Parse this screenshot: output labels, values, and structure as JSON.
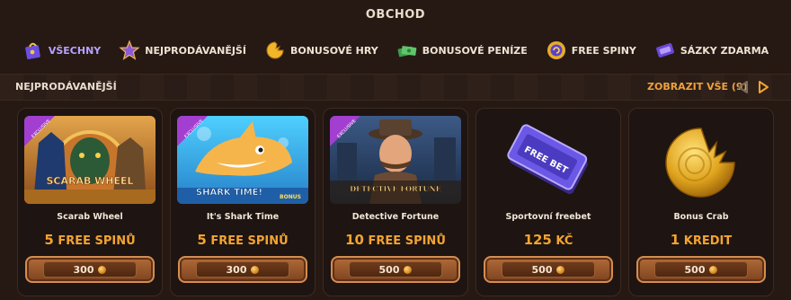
{
  "header": {
    "title": "OBCHOD"
  },
  "filters": [
    {
      "label": "VŠECHNY",
      "icon": "shopping-bag-icon",
      "active": true
    },
    {
      "label": "NEJPRODÁVANĚJŠÍ",
      "icon": "star-icon"
    },
    {
      "label": "BONUSOVÉ HRY",
      "icon": "bonus-crab-icon"
    },
    {
      "label": "BONUSOVÉ PENÍZE",
      "icon": "money-stack-icon"
    },
    {
      "label": "FREE SPINY",
      "icon": "free-spin-coin-icon"
    },
    {
      "label": "SÁZKY ZDARMA",
      "icon": "free-bet-ticket-icon"
    }
  ],
  "section": {
    "title": "NEJPRODÁVANĚJŠÍ",
    "view_all": "ZOBRAZIT VŠE (9)"
  },
  "cards": [
    {
      "name": "Scarab Wheel",
      "amount": "5",
      "unit": "FREE SPINŮ",
      "price": "300",
      "badge": "EXCLUSIVE",
      "thumb_text": "SCARAB WHEEL"
    },
    {
      "name": "It's Shark Time",
      "amount": "5",
      "unit": "FREE SPINŮ",
      "price": "300",
      "badge": "EXCLUSIVE",
      "thumb_text": "SHARK TIME!",
      "thumb_subtext": "BONUS"
    },
    {
      "name": "Detective Fortune",
      "amount": "10",
      "unit": "FREE SPINŮ",
      "price": "500",
      "badge": "EXCLUSIVE",
      "thumb_text": "DETECTIVE FORTUNE"
    },
    {
      "name": "Sportovní freebet",
      "amount": "125",
      "unit": "KČ",
      "price": "500",
      "thumb_text": "FREE BET"
    },
    {
      "name": "Bonus Crab",
      "amount": "1",
      "unit": "KREDIT",
      "price": "500"
    }
  ],
  "colors": {
    "background": "#261914",
    "accent_orange": "#f3a430",
    "active_filter": "#b6a3ff",
    "button_brown": "#9a5a2c"
  }
}
